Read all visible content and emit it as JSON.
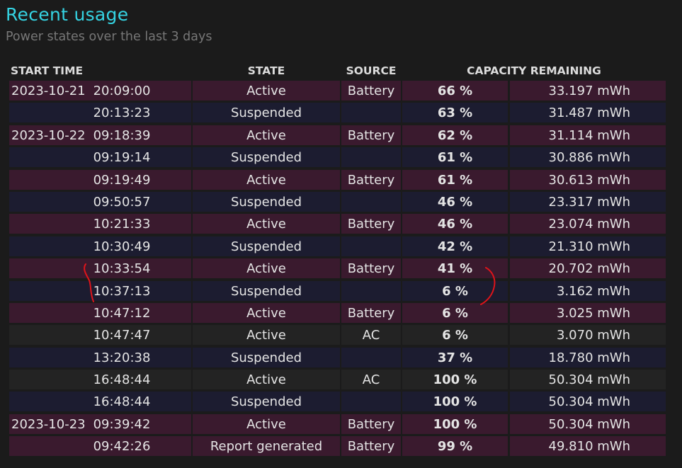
{
  "title": "Recent usage",
  "subtitle": "Power states over the last 3 days",
  "headers": {
    "start_time": "START TIME",
    "state": "STATE",
    "source": "SOURCE",
    "capacity": "CAPACITY REMAINING"
  },
  "colors": {
    "title": "#35d3e2",
    "battery_row": "#3a1a2e",
    "suspended_row": "#1c1c30",
    "ac_row": "#232323",
    "annotation": "#e0141a"
  },
  "rows": [
    {
      "date": "2023-10-21",
      "time": "20:09:00",
      "state": "Active",
      "source": "Battery",
      "pct": "66 %",
      "mwh": "33.197 mWh",
      "kind": "battery"
    },
    {
      "date": "",
      "time": "20:13:23",
      "state": "Suspended",
      "source": "",
      "pct": "63 %",
      "mwh": "31.487 mWh",
      "kind": "suspended"
    },
    {
      "date": "2023-10-22",
      "time": "09:18:39",
      "state": "Active",
      "source": "Battery",
      "pct": "62 %",
      "mwh": "31.114 mWh",
      "kind": "battery"
    },
    {
      "date": "",
      "time": "09:19:14",
      "state": "Suspended",
      "source": "",
      "pct": "61 %",
      "mwh": "30.886 mWh",
      "kind": "suspended"
    },
    {
      "date": "",
      "time": "09:19:49",
      "state": "Active",
      "source": "Battery",
      "pct": "61 %",
      "mwh": "30.613 mWh",
      "kind": "battery"
    },
    {
      "date": "",
      "time": "09:50:57",
      "state": "Suspended",
      "source": "",
      "pct": "46 %",
      "mwh": "23.317 mWh",
      "kind": "suspended"
    },
    {
      "date": "",
      "time": "10:21:33",
      "state": "Active",
      "source": "Battery",
      "pct": "46 %",
      "mwh": "23.074 mWh",
      "kind": "battery"
    },
    {
      "date": "",
      "time": "10:30:49",
      "state": "Suspended",
      "source": "",
      "pct": "42 %",
      "mwh": "21.310 mWh",
      "kind": "suspended"
    },
    {
      "date": "",
      "time": "10:33:54",
      "state": "Active",
      "source": "Battery",
      "pct": "41 %",
      "mwh": "20.702 mWh",
      "kind": "battery"
    },
    {
      "date": "",
      "time": "10:37:13",
      "state": "Suspended",
      "source": "",
      "pct": "6 %",
      "mwh": "3.162 mWh",
      "kind": "suspended"
    },
    {
      "date": "",
      "time": "10:47:12",
      "state": "Active",
      "source": "Battery",
      "pct": "6 %",
      "mwh": "3.025 mWh",
      "kind": "battery"
    },
    {
      "date": "",
      "time": "10:47:47",
      "state": "Active",
      "source": "AC",
      "pct": "6 %",
      "mwh": "3.070 mWh",
      "kind": "ac"
    },
    {
      "date": "",
      "time": "13:20:38",
      "state": "Suspended",
      "source": "",
      "pct": "37 %",
      "mwh": "18.780 mWh",
      "kind": "suspended"
    },
    {
      "date": "",
      "time": "16:48:44",
      "state": "Active",
      "source": "AC",
      "pct": "100 %",
      "mwh": "50.304 mWh",
      "kind": "ac"
    },
    {
      "date": "",
      "time": "16:48:44",
      "state": "Suspended",
      "source": "",
      "pct": "100 %",
      "mwh": "50.304 mWh",
      "kind": "suspended"
    },
    {
      "date": "2023-10-23",
      "time": "09:39:42",
      "state": "Active",
      "source": "Battery",
      "pct": "100 %",
      "mwh": "50.304 mWh",
      "kind": "battery"
    },
    {
      "date": "",
      "time": "09:42:26",
      "state": "Report generated",
      "source": "Battery",
      "pct": "99 %",
      "mwh": "49.810 mWh",
      "kind": "battery"
    }
  ]
}
